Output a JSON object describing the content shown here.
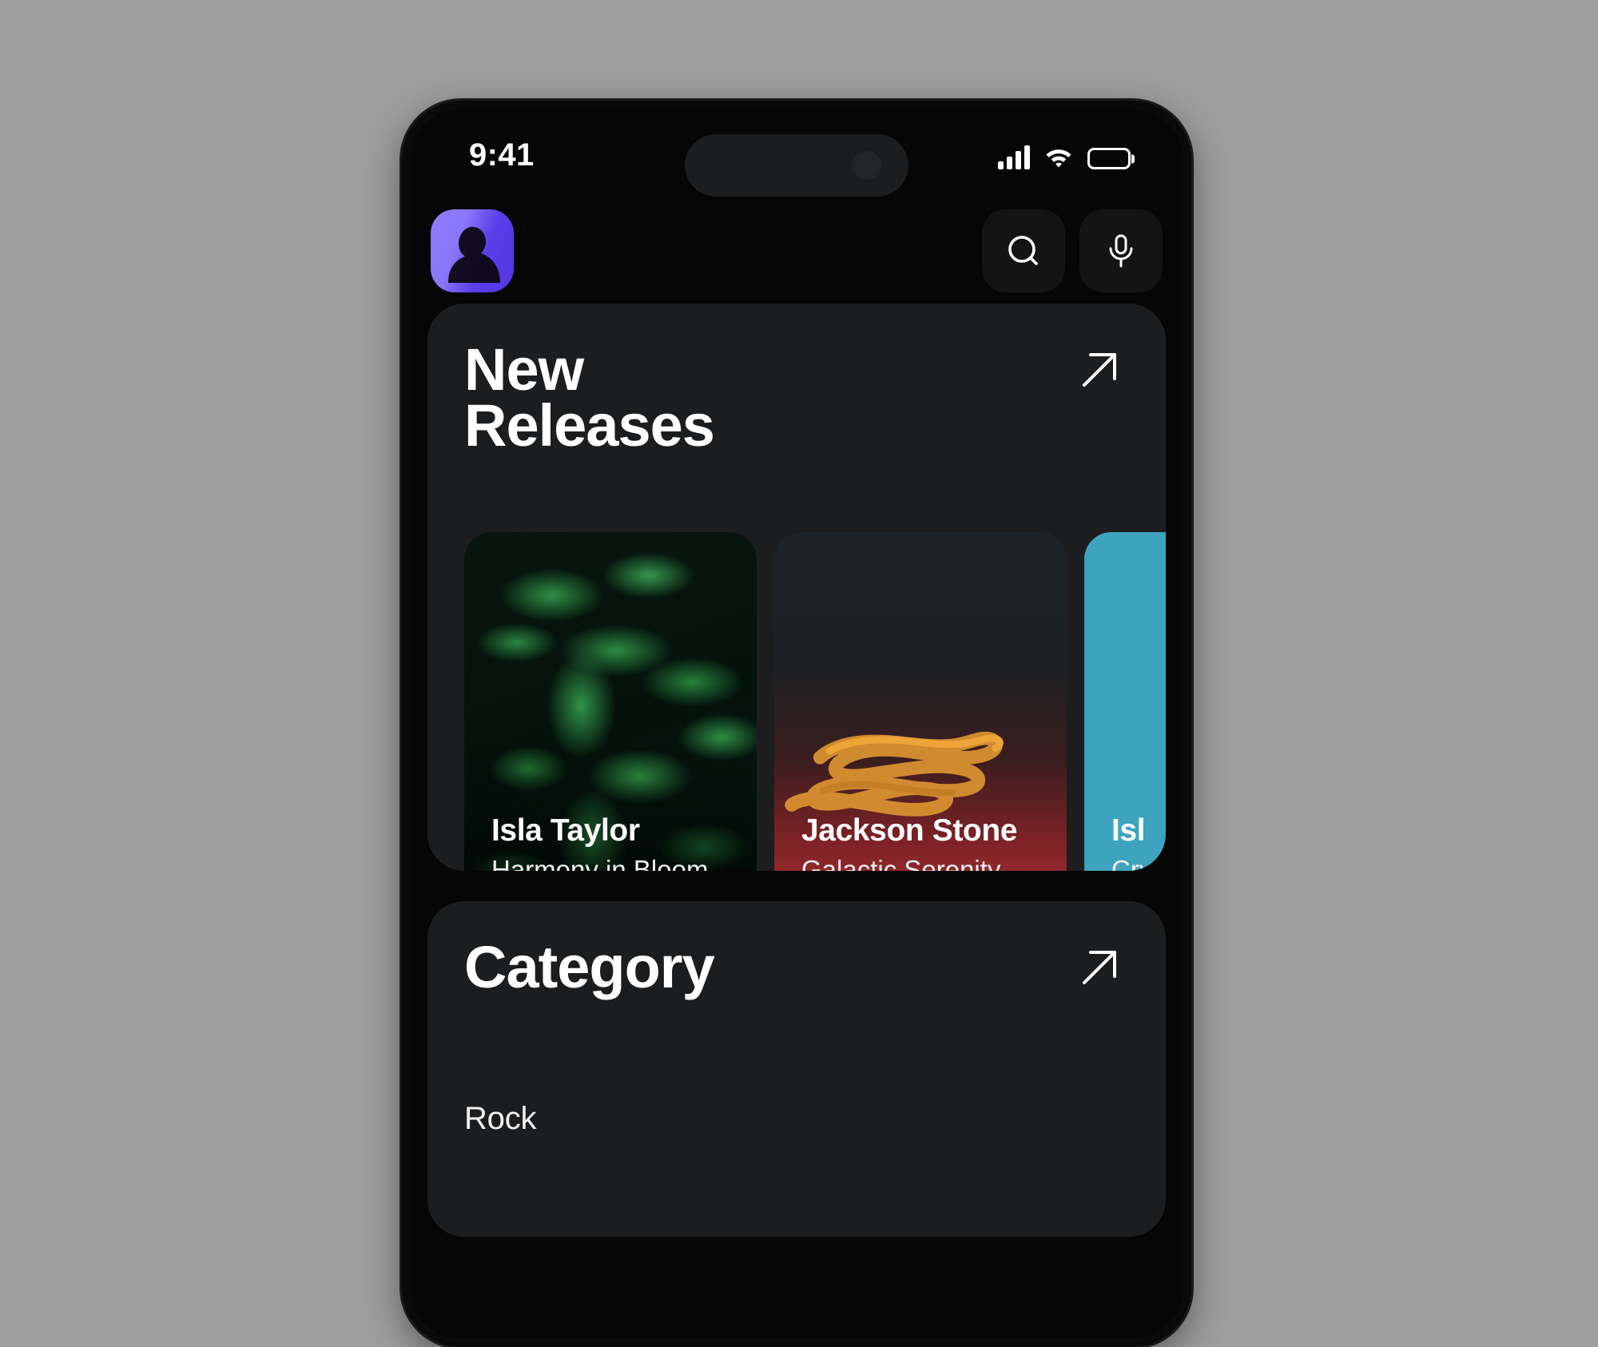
{
  "status_bar": {
    "time": "9:41",
    "cellular_icon": "cellular-signal-icon",
    "wifi_icon": "wifi-icon",
    "battery_icon": "battery-icon"
  },
  "header": {
    "avatar_label": "avatar",
    "search_icon": "search-icon",
    "voice_icon": "microphone-icon"
  },
  "new_releases": {
    "title_line1": "New",
    "title_line2": "Releases",
    "see_all_icon": "arrow-up-right-icon",
    "albums": [
      {
        "artist": "Isla Taylor",
        "title": "Harmony in Bloom",
        "art": "green-leaves"
      },
      {
        "artist": "Jackson Stone",
        "title": "Galactic Serenity",
        "art": "orange-swirl-red-gradient"
      },
      {
        "artist": "Isl",
        "title": "Cry",
        "art": "teal-orange-sun"
      }
    ]
  },
  "category": {
    "title": "Category",
    "see_all_icon": "arrow-up-right-icon",
    "items": [
      {
        "label": "Rock"
      }
    ]
  },
  "colors": {
    "page_background": "#9e9e9e",
    "phone_frame": "#0a0a0a",
    "screen_background": "#060606",
    "section_card": "#1b1d1f",
    "accent_purple": "#5a3fe8",
    "text_primary": "#ffffff",
    "teal_art": "#3da3be",
    "orange_art": "#f59412"
  }
}
